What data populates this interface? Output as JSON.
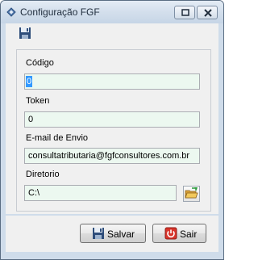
{
  "window": {
    "title": "Configuração FGF"
  },
  "form": {
    "codigo": {
      "label": "Código",
      "value": "0"
    },
    "token": {
      "label": "Token",
      "value": "0"
    },
    "email": {
      "label": "E-mail de Envio",
      "value": "consultatributaria@fgfconsultores.com.br"
    },
    "diretorio": {
      "label": "Diretorio",
      "value": "C:\\"
    }
  },
  "buttons": {
    "salvar": "Salvar",
    "sair": "Sair"
  },
  "icons": {
    "toolbar": "save-icon",
    "folder": "folder-open-icon",
    "salvar": "floppy-disk-icon",
    "sair": "power-icon"
  },
  "colors": {
    "field_bg": "#ecf8f0",
    "selection": "#3399ff",
    "window_frame": "#cfdcea"
  }
}
